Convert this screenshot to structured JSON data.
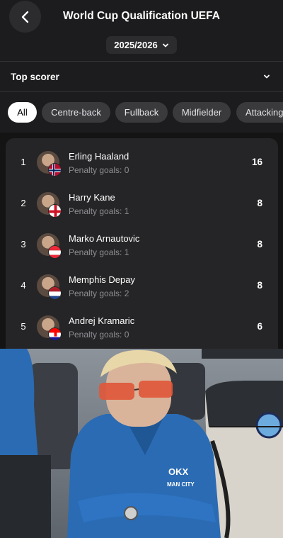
{
  "header": {
    "title": "World Cup Qualification UEFA",
    "season": "2025/2026"
  },
  "stat_selector": {
    "label": "Top scorer"
  },
  "filters": [
    {
      "label": "All",
      "active": true
    },
    {
      "label": "Centre-back",
      "active": false
    },
    {
      "label": "Fullback",
      "active": false
    },
    {
      "label": "Midfielder",
      "active": false
    },
    {
      "label": "Attacking",
      "active": false
    }
  ],
  "players": [
    {
      "rank": "1",
      "name": "Erling Haaland",
      "penalty": "Penalty goals: 0",
      "goals": "16",
      "flag": "norway-flag"
    },
    {
      "rank": "2",
      "name": "Harry Kane",
      "penalty": "Penalty goals: 1",
      "goals": "8",
      "flag": "england-flag"
    },
    {
      "rank": "3",
      "name": "Marko Arnautovic",
      "penalty": "Penalty goals: 1",
      "goals": "8",
      "flag": "austria-flag"
    },
    {
      "rank": "4",
      "name": "Memphis Depay",
      "penalty": "Penalty goals: 2",
      "goals": "8",
      "flag": "netherlands-flag"
    },
    {
      "rank": "5",
      "name": "Andrej Kramaric",
      "penalty": "Penalty goals: 0",
      "goals": "6",
      "flag": "croatia-flag"
    }
  ],
  "photo": {
    "jersey_text_1": "OKX",
    "jersey_text_2": "MAN CITY"
  },
  "colors": {
    "background": "#1c1c1e",
    "card": "#252527",
    "chip": "#3a3a3c",
    "active_chip": "#ffffff",
    "muted_text": "#8e8e93",
    "jersey_blue": "#2a6bb4"
  }
}
